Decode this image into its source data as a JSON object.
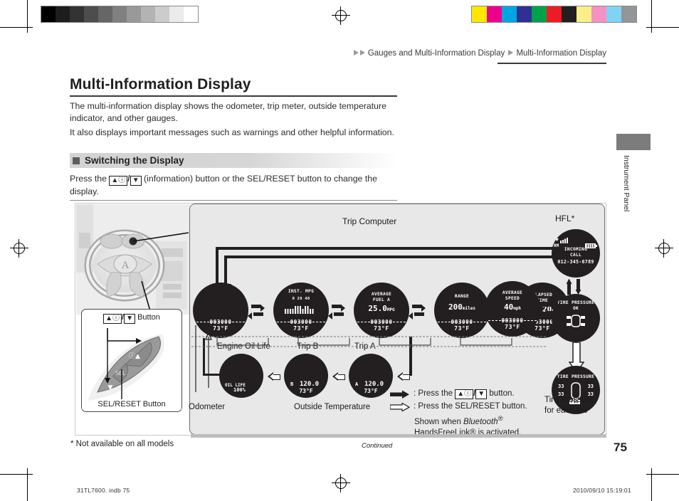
{
  "breadcrumb": {
    "part1": "Gauges and Multi-Information Display",
    "part2": "Multi-Information Display"
  },
  "page": {
    "title": "Multi-Information Display",
    "intro1": "The multi-information display shows the odometer, trip meter, outside temperature indicator, and other gauges.",
    "intro2": "It also displays important messages such as warnings and other helpful information.",
    "section_heading": "Switching the Display",
    "instruction_pre": "Press the ",
    "instruction_post": " (information) button or the SEL/RESET button to change the display.",
    "footnote": "* Not available on all models",
    "continued": "Continued",
    "page_number": "75",
    "side_tab_label": "Instrument Panel"
  },
  "keys": {
    "up_info": "▲ⓘ",
    "down": "▼",
    "slash": "/"
  },
  "figure": {
    "trip_computer_label": "Trip Computer",
    "hfl_label": "HFL*",
    "button_label": "Button",
    "sel_reset_label": "SEL/RESET Button",
    "engine_oil_life_label": "Engine Oil Life",
    "trip_b_label": "Trip B",
    "trip_a_label": "Trip A",
    "odometer_label": "Odometer",
    "outside_temp_label": "Outside Temperature",
    "tire_pressure_caption_1": "Tire Pressure",
    "tire_pressure_caption_2": "for each tire"
  },
  "displays": {
    "odometer": {
      "title": "",
      "value": "",
      "odo": "003000",
      "temp": "73°F"
    },
    "inst_mpg": {
      "title": "INST. MPG",
      "scale": "0     20     40",
      "odo": "003000",
      "temp": "73°F"
    },
    "average_fuel": {
      "title1": "AVERAGE",
      "title2": "FUEL  A",
      "value": "25.0",
      "unit": "MPG",
      "odo": "003000",
      "temp": "73°F"
    },
    "range": {
      "title": "RANGE",
      "value": "200",
      "unit": "miles",
      "odo": "003000",
      "temp": "73°F"
    },
    "elapsed_time": {
      "title1": "ELAPSED",
      "title2": "TIME",
      "value": "1h 20m",
      "odo": "003000",
      "temp": "73°F"
    },
    "average_speed": {
      "title1": "AVERAGE",
      "title2": "SPEED",
      "value": "40",
      "unit": "mph",
      "odo": "003000",
      "temp": "73°F"
    },
    "hfl": {
      "roam": "RM",
      "line1": "INCOMING",
      "line2": "CALL",
      "line3": "012-345-6789"
    },
    "tire_pressure_ok": {
      "title1": "TIRE PRESSURE",
      "title2": "OK"
    },
    "tire_pressure_detail": {
      "title": "TIRE PRESSURE",
      "fl": "33",
      "fr": "33",
      "rl": "33",
      "rr": "33",
      "unit": "PSI"
    },
    "oil_life": {
      "title": "OIL LIFE",
      "value": "100%"
    },
    "trip_b": {
      "id": "B",
      "value": "120.0",
      "temp": "73°F"
    },
    "trip_a": {
      "id": "A",
      "value": "120.0",
      "temp": "73°F"
    }
  },
  "legend": {
    "solid_arrow_text": "Press the",
    "solid_arrow_suffix": "button.",
    "hollow_arrow_text": ": Press the SEL/RESET button.",
    "note_line1_pre": "Shown when ",
    "note_line1_em": "Bluetooth",
    "note_line1_sup": "®",
    "note_line2": "HandsFreeLink® is activated.",
    "colon": ":"
  },
  "runfoot": {
    "left": "31TL7600. indb     75",
    "right": "2010/09/10     15:19:01"
  },
  "swatches": {
    "grey": [
      "#000000",
      "#1d1d1d",
      "#333333",
      "#4d4d4d",
      "#666666",
      "#808080",
      "#999999",
      "#b3b3b3",
      "#cccccc",
      "#ebebeb",
      "#ffffff"
    ],
    "color": [
      "#ffe800",
      "#ec008c",
      "#00a6e2",
      "#2e3192",
      "#00a14b",
      "#ed1c24",
      "#231f20",
      "#fbef8a",
      "#f691c4",
      "#7fd4f5",
      "#939598"
    ]
  }
}
